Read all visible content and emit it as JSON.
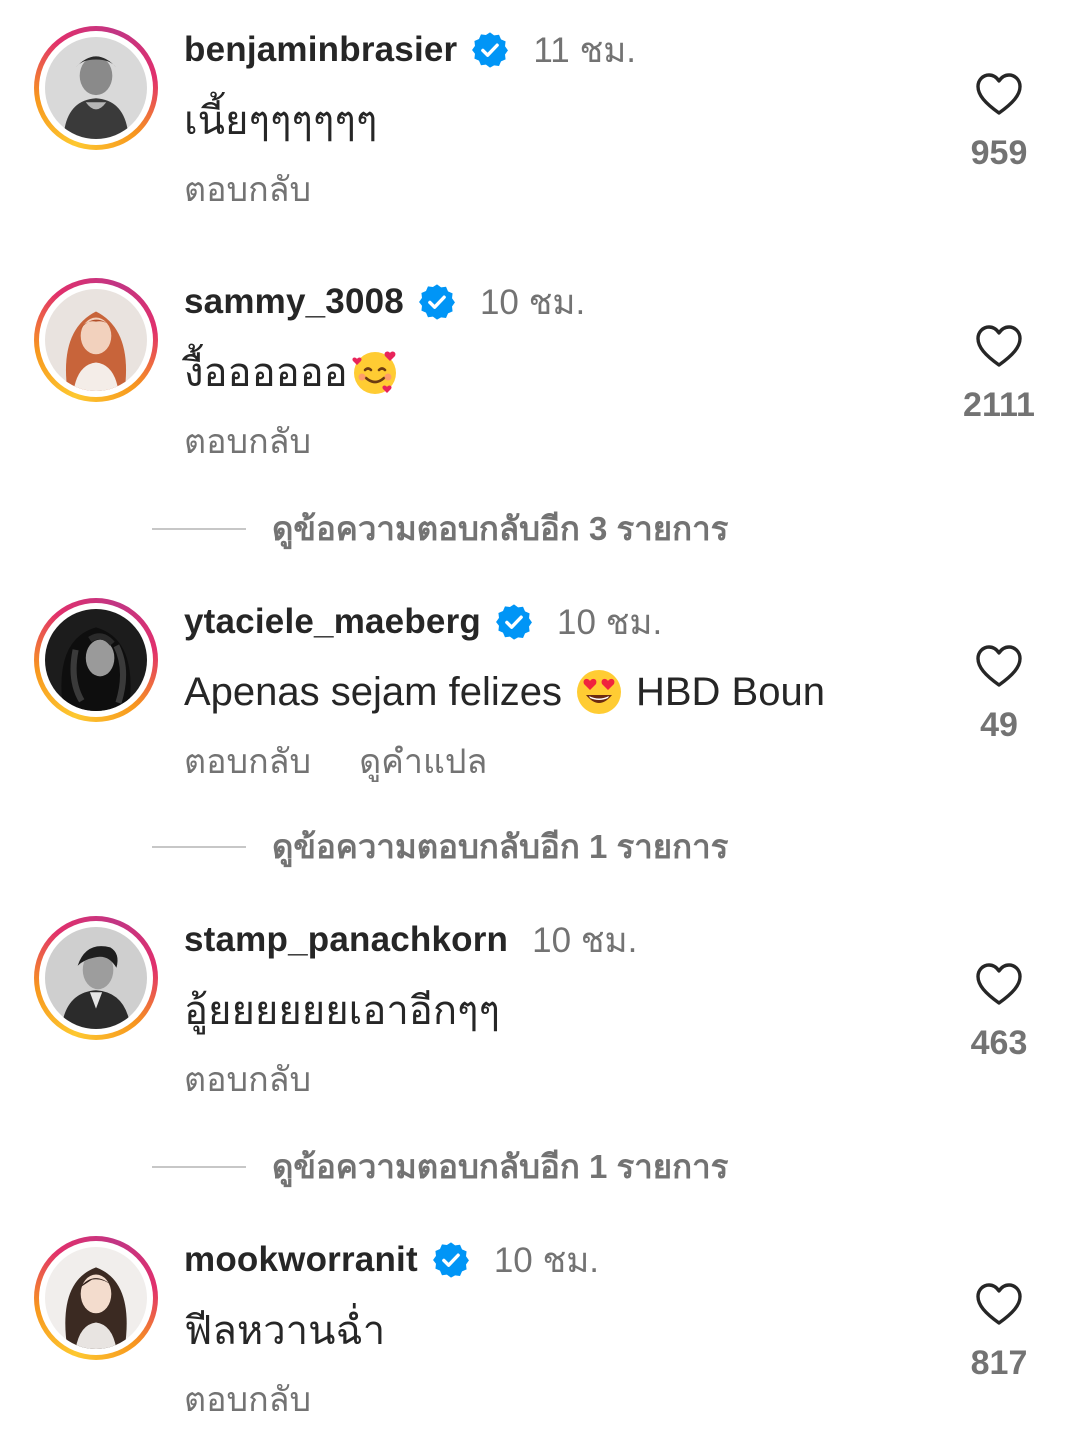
{
  "comments": [
    {
      "username": "benjaminbrasier",
      "verified": true,
      "time": "11 ชม.",
      "text": "เนี้ยๆๆๆๆๆๆ",
      "reply_label": "ตอบกลับ",
      "likes": "959"
    },
    {
      "username": "sammy_3008",
      "verified": true,
      "time": "10 ชม.",
      "text": "งื้ออออออ",
      "emoji": "smiling-face-with-hearts-emoji",
      "reply_label": "ตอบกลับ",
      "likes": "2111"
    },
    {
      "username": "ytaciele_maeberg",
      "verified": true,
      "time": "10 ชม.",
      "text_before": "Apenas sejam felizes",
      "emoji": "heart-eyes-emoji",
      "text_after": "HBD Boun",
      "reply_label": "ตอบกลับ",
      "translate_label": "ดูคำแปล",
      "likes": "49"
    },
    {
      "username": "stamp_panachkorn",
      "verified": false,
      "time": "10 ชม.",
      "text": "อู้ยยยยยยเอาอีกๆๆ",
      "reply_label": "ตอบกลับ",
      "likes": "463"
    },
    {
      "username": "mookworranit",
      "verified": true,
      "time": "10 ชม.",
      "text": "ฟีลหวานฉ่ำ",
      "reply_label": "ตอบกลับ",
      "likes": "817"
    }
  ],
  "view_replies": [
    {
      "label": "ดูข้อความตอบกลับอีก 3 รายการ"
    },
    {
      "label": "ดูข้อความตอบกลับอีก 1 รายการ"
    },
    {
      "label": "ดูข้อความตอบกลับอีก 1 รายการ"
    }
  ],
  "colors": {
    "verified_blue": "#0095f6",
    "muted_text": "#737373",
    "primary_text": "#262626"
  }
}
